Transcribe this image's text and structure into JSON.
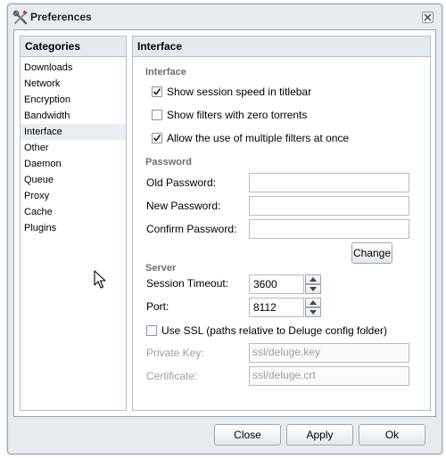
{
  "window": {
    "title": "Preferences",
    "title_icon": "tools-icon",
    "close_icon": "close-icon"
  },
  "categories": {
    "header": "Categories",
    "items": [
      "Downloads",
      "Network",
      "Encryption",
      "Bandwidth",
      "Interface",
      "Other",
      "Daemon",
      "Queue",
      "Proxy",
      "Cache",
      "Plugins"
    ],
    "selected": "Interface"
  },
  "panel": {
    "header": "Interface",
    "interface_section": "Interface",
    "options": [
      {
        "label": "Show session speed in titlebar",
        "checked": true
      },
      {
        "label": "Show filters with zero torrents",
        "checked": false
      },
      {
        "label": "Allow the use of multiple filters at once",
        "checked": true
      }
    ],
    "password_section": "Password",
    "old_password_label": "Old Password:",
    "new_password_label": "New Password:",
    "confirm_password_label": "Confirm Password:",
    "change_button": "Change",
    "server_section": "Server",
    "session_timeout_label": "Session Timeout:",
    "session_timeout_value": "3600",
    "port_label": "Port:",
    "port_value": "8112",
    "use_ssl_label": "Use SSL (paths relative to Deluge config folder)",
    "use_ssl_checked": false,
    "private_key_label": "Private Key:",
    "private_key_value": "ssl/deluge.key",
    "certificate_label": "Certificate:",
    "certificate_value": "ssl/deluge.crt"
  },
  "footer": {
    "close_button": "Close",
    "apply_button": "Apply",
    "ok_button": "Ok"
  },
  "colors": {
    "window_bg": "#e6ebf0",
    "border": "#99a2ab",
    "selected_row": "#eaeef2",
    "section_label": "#6a6f75"
  }
}
